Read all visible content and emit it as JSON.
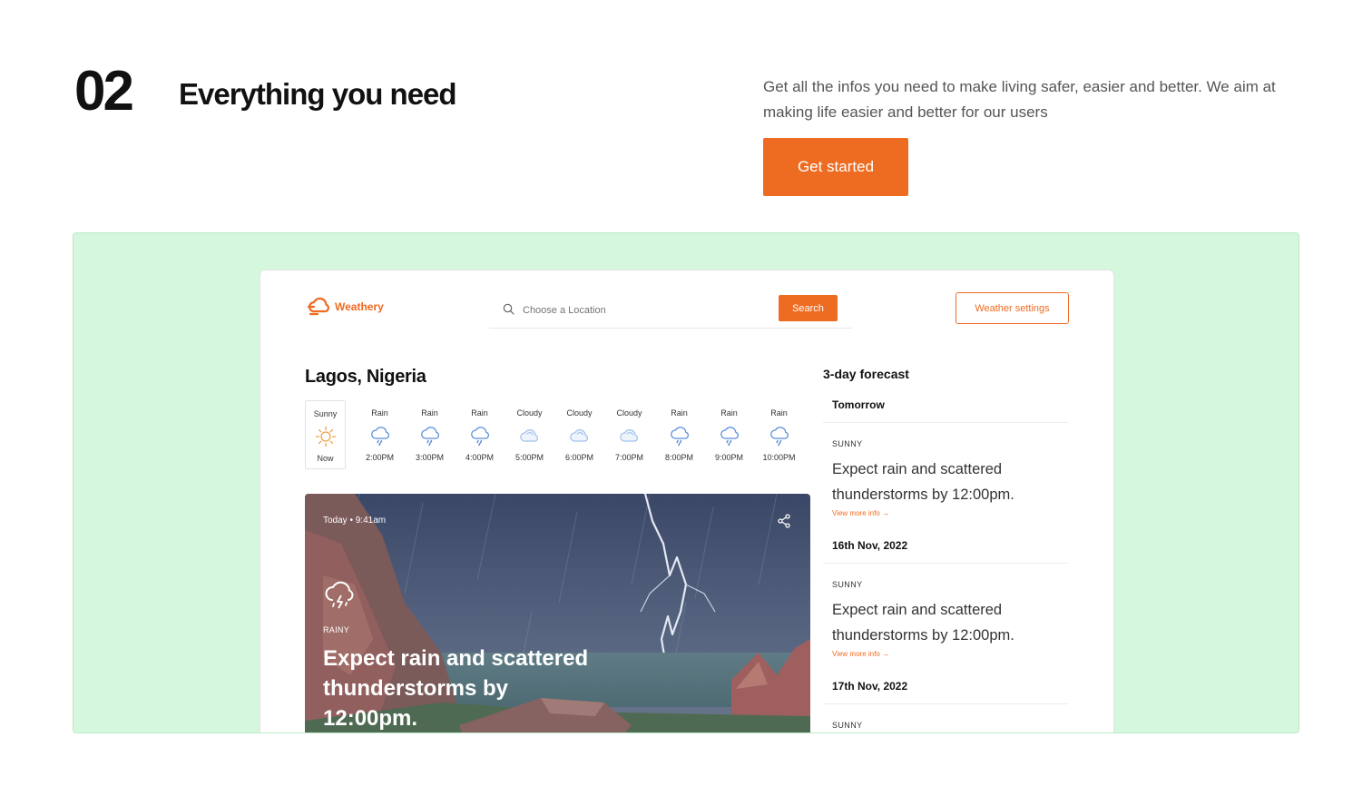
{
  "section": {
    "number": "02",
    "title": "Everything you need",
    "description": "Get all the infos you need to make living safer, easier and better. We aim at making life easier and better for our users",
    "cta_label": "Get started"
  },
  "app": {
    "brand": "Weathery",
    "search": {
      "placeholder": "Choose a Location",
      "button_label": "Search"
    },
    "settings_label": "Weather settings",
    "city": "Lagos, Nigeria",
    "hourly": [
      {
        "cond": "Sunny",
        "icon": "sun-icon",
        "time": "Now"
      },
      {
        "cond": "Rain",
        "icon": "rain-icon",
        "time": "2:00PM"
      },
      {
        "cond": "Rain",
        "icon": "rain-icon",
        "time": "3:00PM"
      },
      {
        "cond": "Rain",
        "icon": "rain-icon",
        "time": "4:00PM"
      },
      {
        "cond": "Cloudy",
        "icon": "cloud-icon",
        "time": "5:00PM"
      },
      {
        "cond": "Cloudy",
        "icon": "cloud-icon",
        "time": "6:00PM"
      },
      {
        "cond": "Cloudy",
        "icon": "cloud-icon",
        "time": "7:00PM"
      },
      {
        "cond": "Rain",
        "icon": "rain-icon",
        "time": "8:00PM"
      },
      {
        "cond": "Rain",
        "icon": "rain-icon",
        "time": "9:00PM"
      },
      {
        "cond": "Rain",
        "icon": "rain-icon",
        "time": "10:00PM"
      }
    ],
    "hero": {
      "date": "Today • 9:41am",
      "condition": "RAINY",
      "text": "Expect rain and scattered thunderstorms by 12:00pm."
    },
    "forecast": {
      "title": "3-day forecast",
      "days": [
        {
          "day": "Tomorrow",
          "cond": "SUNNY",
          "text": "Expect rain and scattered thunderstorms by 12:00pm.",
          "link": "View more info →"
        },
        {
          "day": "16th Nov, 2022",
          "cond": "SUNNY",
          "text": "Expect rain and scattered thunderstorms by 12:00pm.",
          "link": "View more info →"
        },
        {
          "day": "17th Nov, 2022",
          "cond": "SUNNY",
          "text": "",
          "link": ""
        }
      ]
    }
  },
  "colors": {
    "accent": "#ee6b22",
    "stage": "#d4f7dd",
    "icon_blue": "#5b8fd9"
  }
}
